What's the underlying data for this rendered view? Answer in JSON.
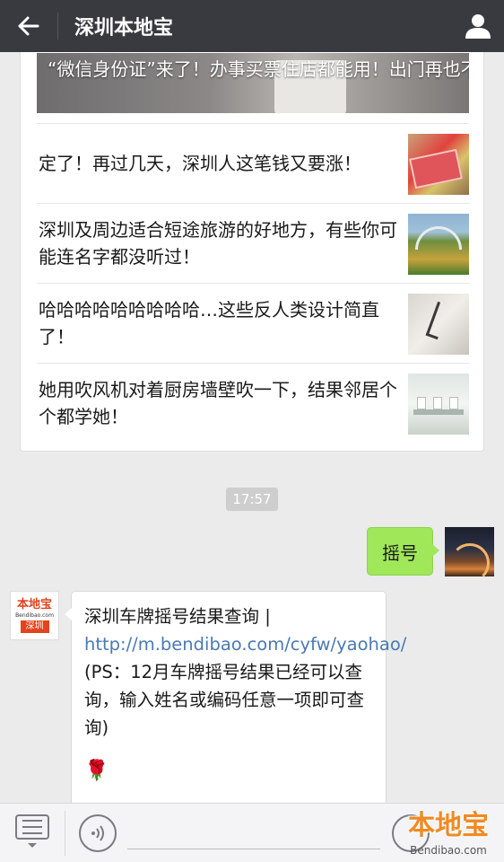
{
  "header": {
    "title": "深圳本地宝"
  },
  "articles": {
    "hero_title": "“微信身份证”来了！办事买票住店都能用！出门再也不用带身份证了",
    "items": [
      {
        "title": "定了！再过几天，深圳人这笔钱又要涨！",
        "thumb": "rmb-banknotes"
      },
      {
        "title": "深圳及周边适合短途旅游的好地方，有些你可能连名字都没听过！",
        "thumb": "garden-greenhouse"
      },
      {
        "title": "哈哈哈哈哈哈哈哈哈…这些反人类设计简直了！",
        "thumb": "person-on-wall"
      },
      {
        "title": "她用吹风机对着厨房墙壁吹一下，结果邻居个个都学她！",
        "thumb": "kitchen-shelf"
      }
    ]
  },
  "chat": {
    "time": "17:57",
    "sent": {
      "text": "摇号"
    },
    "received": {
      "text_prefix": "深圳车牌摇号结果查询 | ",
      "link": "http://m.bendibao.com/cyfw/yaohao/",
      "text_suffix": "(PS：12月车牌摇号结果已经可以查询，输入姓名或编码任意一项即可查询)",
      "emoji": "🌹"
    },
    "bot_avatar": {
      "logo_top": "本地宝",
      "logo_mid": "Bendibao.com",
      "logo_bottom": "深圳"
    }
  },
  "watermark": {
    "main": "本地宝",
    "sub": "Bendibao.com"
  },
  "colors": {
    "topbar": "#393a3f",
    "sent_bubble": "#a0e75a",
    "link": "#4a7ab5",
    "accent": "#e3431e"
  }
}
